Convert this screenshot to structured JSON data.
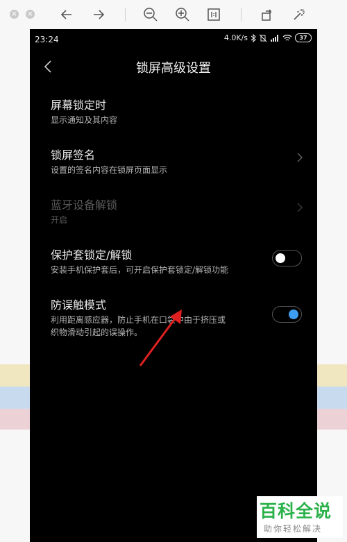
{
  "statusbar": {
    "time": "23:24",
    "speed": "4.0K/s",
    "battery": "37"
  },
  "header": {
    "title": "锁屏高级设置"
  },
  "items": [
    {
      "title": "屏幕锁定时",
      "subtitle": "显示通知及其内容"
    },
    {
      "title": "锁屏签名",
      "subtitle": "设置的签名内容在锁屏页面显示"
    },
    {
      "title": "蓝牙设备解锁",
      "subtitle": "开启"
    },
    {
      "title": "保护套锁定/解锁",
      "subtitle": "安装手机保护套后，可开启保护套锁定/解锁功能",
      "toggle": "off"
    },
    {
      "title": "防误触模式",
      "subtitle_line1": "利用距离感应器，防止手机在口袋中由于挤压或",
      "subtitle_line2": "织物滑动引起的误操作。",
      "toggle": "on"
    }
  ],
  "watermark": {
    "logo": "百科全说",
    "sub": "助你轻松解决"
  },
  "colors": {
    "toggle_on": "#3d9bf0",
    "annotation_arrow": "#e02020",
    "watermark_green": "#2bb14a"
  },
  "icons": [
    "close-icon",
    "minimize-icon",
    "back-arrow-icon",
    "forward-arrow-icon",
    "zoom-out-icon",
    "zoom-in-icon",
    "actual-size-icon",
    "rotate-icon",
    "magic-wand-icon",
    "bluetooth-icon",
    "signal-icon",
    "wifi-icon",
    "chevron-right-icon"
  ]
}
